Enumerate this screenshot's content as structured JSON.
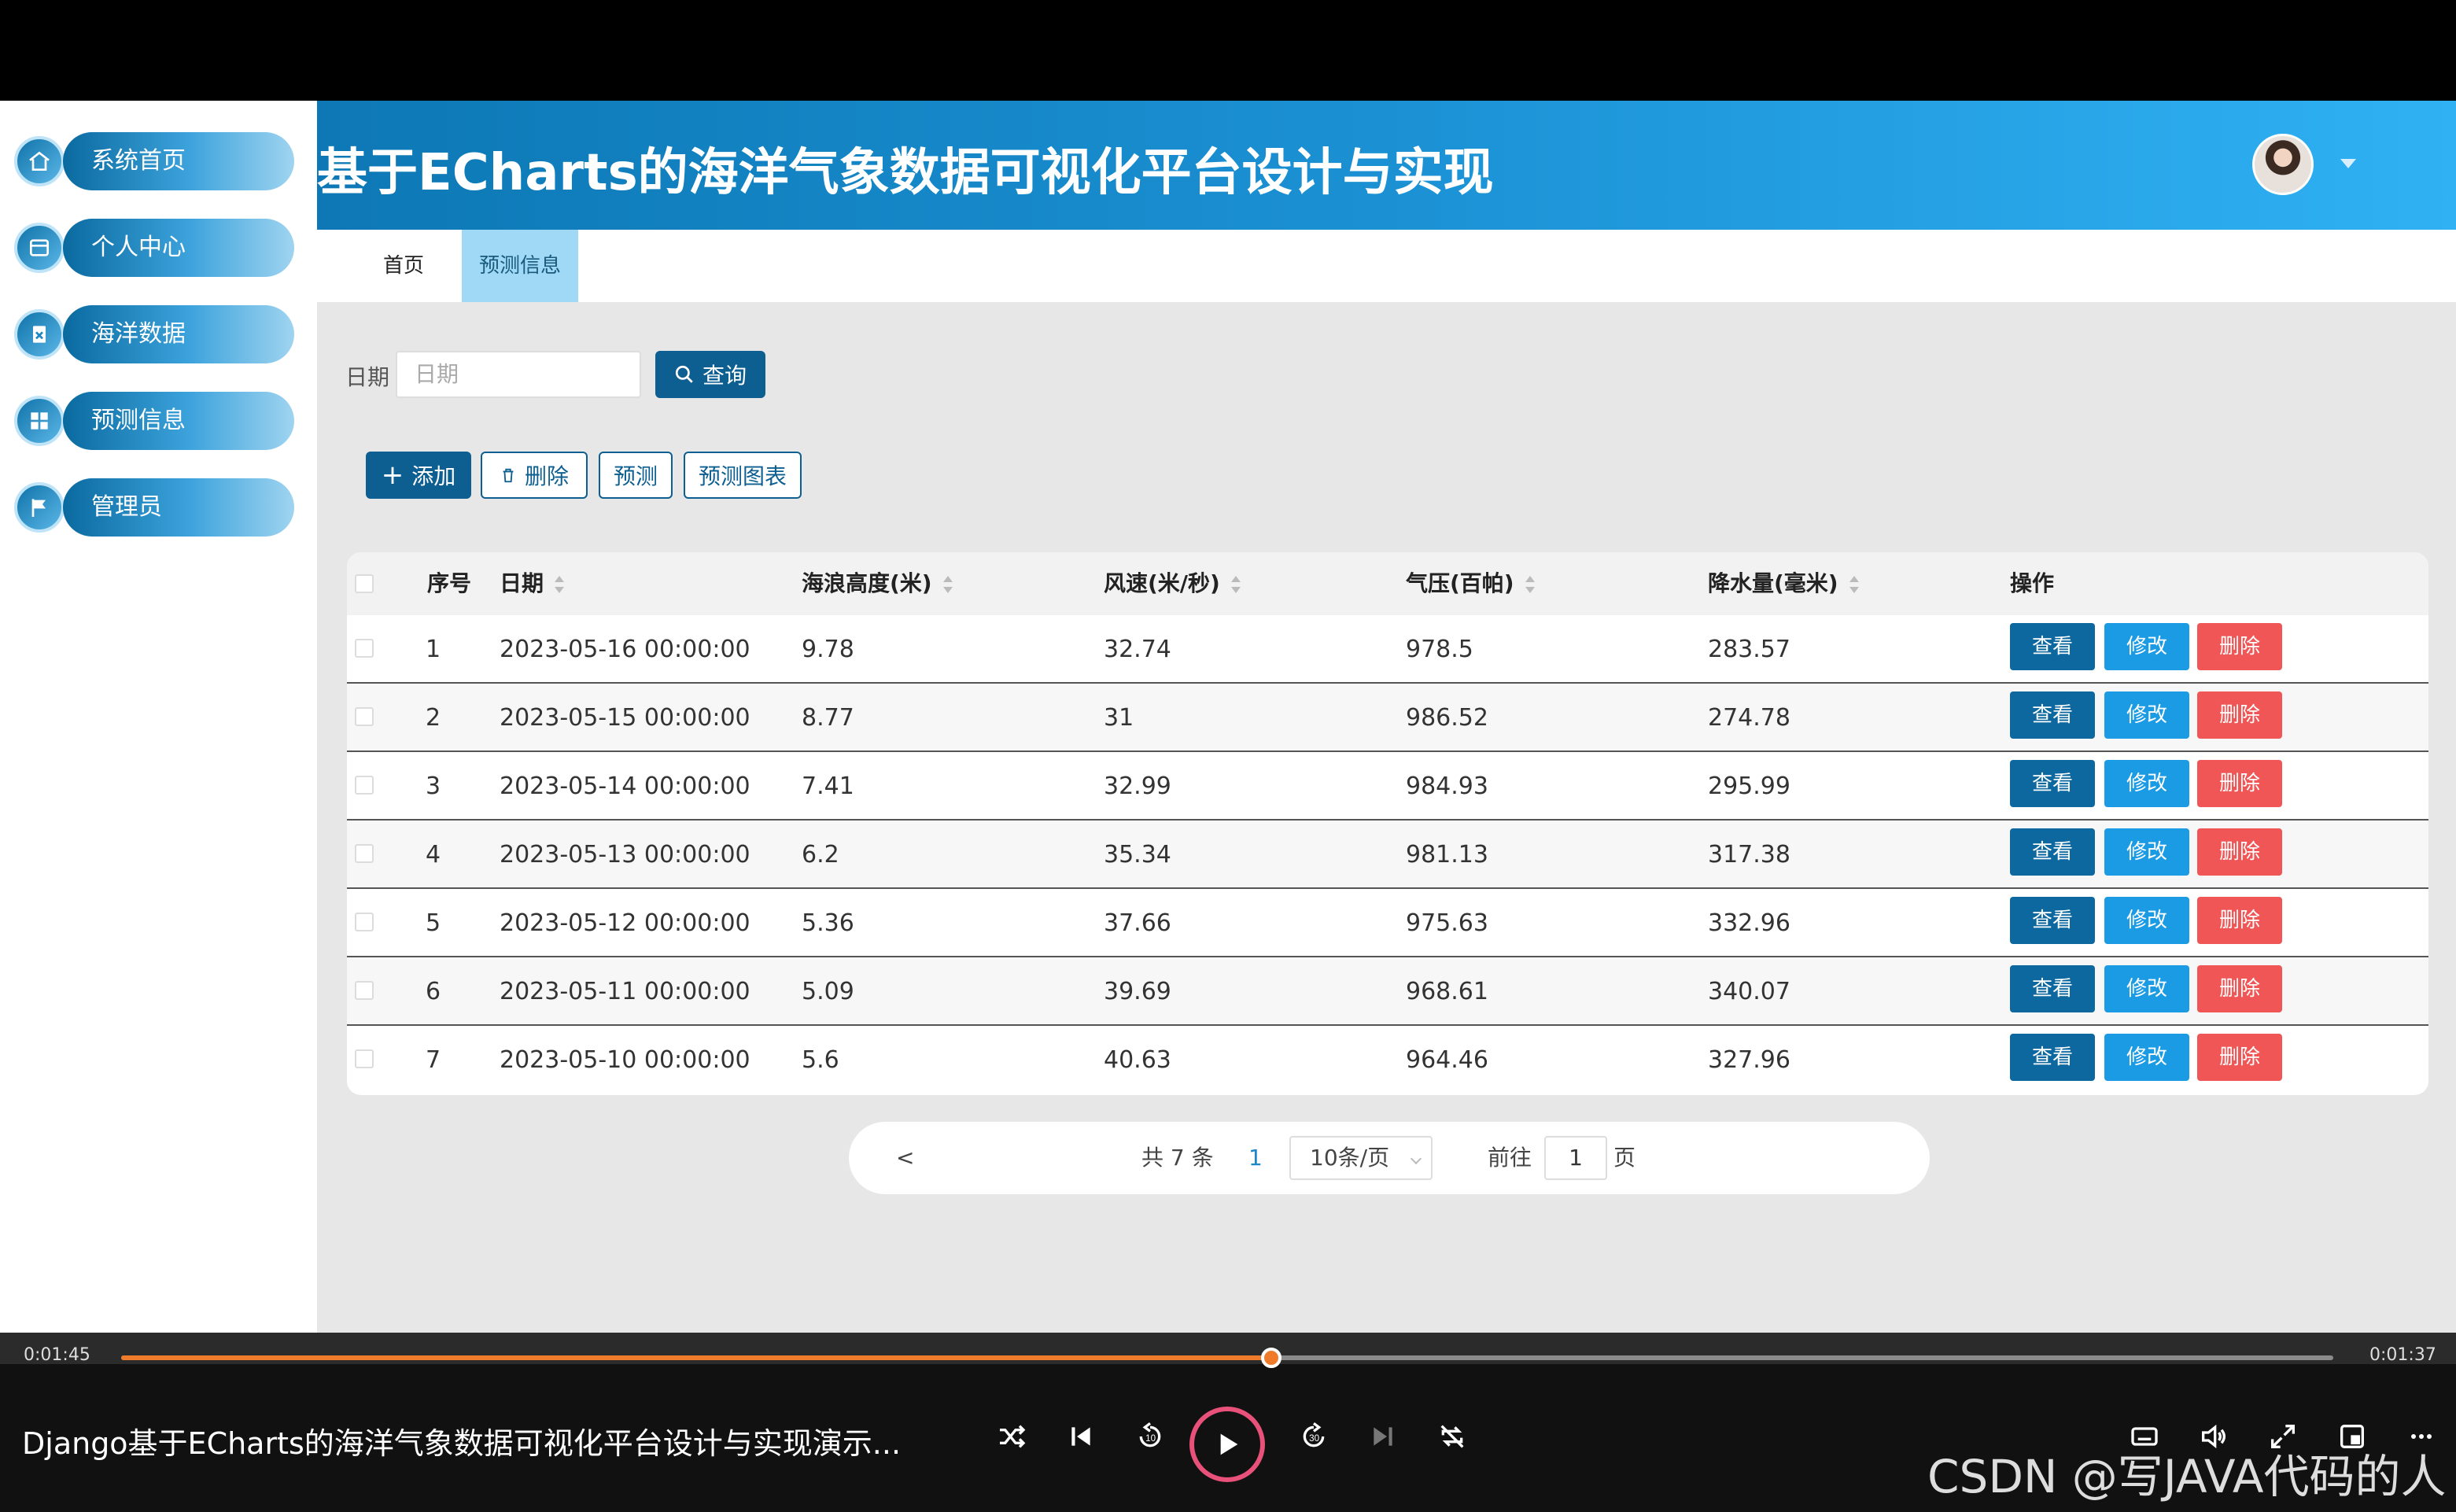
{
  "app": {
    "title": "基于ECharts的海洋气象数据可视化平台设计与实现"
  },
  "sidebar": {
    "items": [
      {
        "label": "系统首页",
        "icon": "home-icon"
      },
      {
        "label": "个人中心",
        "icon": "card-icon"
      },
      {
        "label": "海洋数据",
        "icon": "clipboard-icon"
      },
      {
        "label": "预测信息",
        "icon": "grid-icon"
      },
      {
        "label": "管理员",
        "icon": "flag-icon"
      }
    ]
  },
  "tabs": [
    {
      "label": "首页",
      "active": false
    },
    {
      "label": "预测信息",
      "active": true
    }
  ],
  "search": {
    "label": "日期",
    "placeholder": "日期",
    "button": "查询"
  },
  "toolbar": {
    "add": "添加",
    "delete": "删除",
    "predict": "预测",
    "chart": "预测图表"
  },
  "table": {
    "headers": [
      "序号",
      "日期",
      "海浪高度(米)",
      "风速(米/秒)",
      "气压(百帕)",
      "降水量(毫米)",
      "操作"
    ],
    "rows": [
      {
        "index": "1",
        "date": "2023-05-16 00:00:00",
        "wave": "9.78",
        "wind": "32.74",
        "pressure": "978.5",
        "rain": "283.57"
      },
      {
        "index": "2",
        "date": "2023-05-15 00:00:00",
        "wave": "8.77",
        "wind": "31",
        "pressure": "986.52",
        "rain": "274.78"
      },
      {
        "index": "3",
        "date": "2023-05-14 00:00:00",
        "wave": "7.41",
        "wind": "32.99",
        "pressure": "984.93",
        "rain": "295.99"
      },
      {
        "index": "4",
        "date": "2023-05-13 00:00:00",
        "wave": "6.2",
        "wind": "35.34",
        "pressure": "981.13",
        "rain": "317.38"
      },
      {
        "index": "5",
        "date": "2023-05-12 00:00:00",
        "wave": "5.36",
        "wind": "37.66",
        "pressure": "975.63",
        "rain": "332.96"
      },
      {
        "index": "6",
        "date": "2023-05-11 00:00:00",
        "wave": "5.09",
        "wind": "39.69",
        "pressure": "968.61",
        "rain": "340.07"
      },
      {
        "index": "7",
        "date": "2023-05-10 00:00:00",
        "wave": "5.6",
        "wind": "40.63",
        "pressure": "964.46",
        "rain": "327.96"
      }
    ],
    "actions": {
      "view": "查看",
      "edit": "修改",
      "delete": "删除"
    }
  },
  "pagination": {
    "prev": "<",
    "total": "共 7 条",
    "current": "1",
    "page_size": "10条/页",
    "goto_label": "前往",
    "goto_value": "1",
    "goto_suffix": "页"
  },
  "player": {
    "elapsed": "0:01:45",
    "remaining": "0:01:37",
    "progress": 0.52,
    "title": "Django基于ECharts的海洋气象数据可视化平台设计与实现演示...",
    "watermark": "CSDN @写JAVA代码的人"
  },
  "colors": {
    "primary": "#0e5f91",
    "edit": "#1c9be5",
    "danger": "#f15656",
    "accent": "#f07b2a"
  }
}
